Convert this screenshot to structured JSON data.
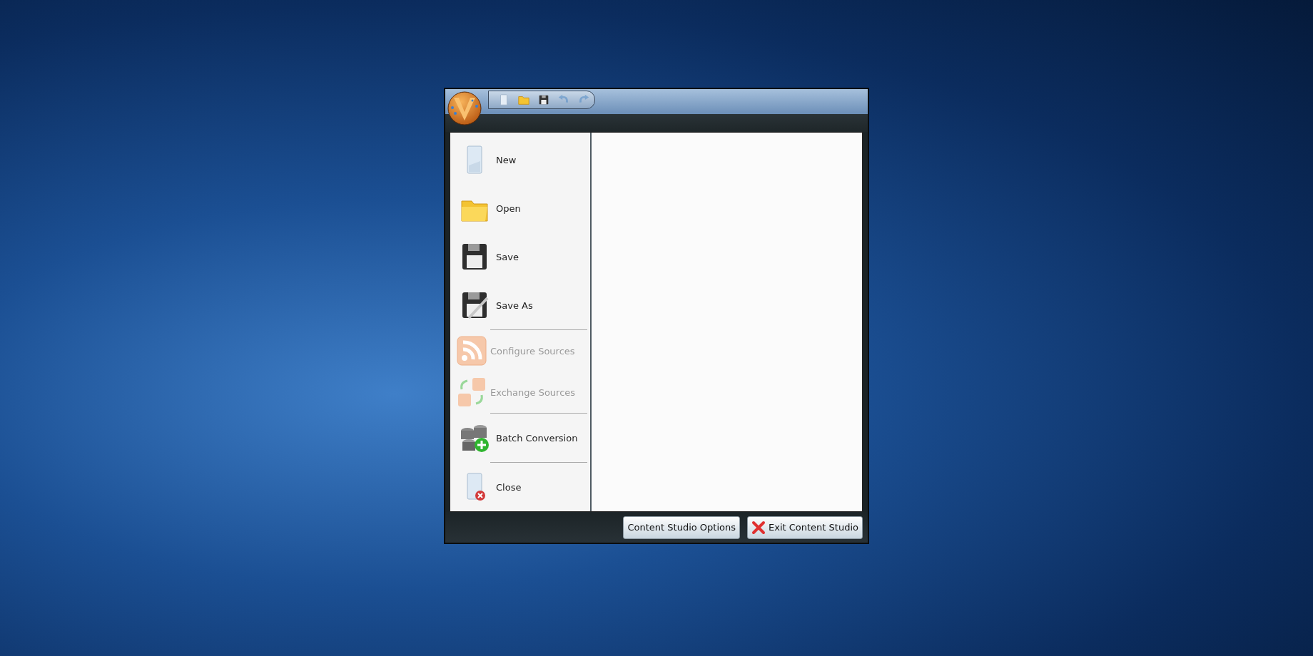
{
  "quick_access": [
    {
      "disabled": false
    },
    {
      "disabled": false
    },
    {
      "disabled": false
    },
    {
      "disabled": true
    },
    {
      "disabled": true
    }
  ],
  "menu": [
    {
      "kind": "item",
      "label": "New",
      "disabled": false
    },
    {
      "kind": "item",
      "label": "Open",
      "disabled": false
    },
    {
      "kind": "item",
      "label": "Save",
      "disabled": false
    },
    {
      "kind": "item",
      "label": "Save As",
      "disabled": false
    },
    {
      "kind": "separator"
    },
    {
      "kind": "item",
      "label": "Configure Sources",
      "disabled": true
    },
    {
      "kind": "item",
      "label": "Exchange Sources",
      "disabled": true
    },
    {
      "kind": "separator"
    },
    {
      "kind": "item",
      "label": "Batch Conversion",
      "disabled": false
    },
    {
      "kind": "separator"
    },
    {
      "kind": "item",
      "label": "Close",
      "disabled": false
    }
  ],
  "buttons": [
    {
      "label": "Content Studio Options"
    },
    {
      "label": "Exit Content Studio"
    }
  ]
}
